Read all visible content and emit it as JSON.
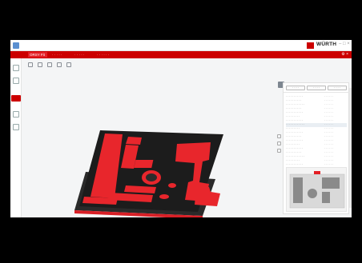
{
  "window": {
    "brand": "WÜRTH",
    "controls": "– □ ×"
  },
  "tabs": [
    {
      "label": "ORSY Fit"
    },
    {
      "label": "· · · · ·"
    },
    {
      "label": "· · · · ·"
    },
    {
      "label": "· · · · · ·"
    }
  ],
  "redbar_right": "⚙ ×",
  "toolbar": {
    "items": [
      {
        "icon": "undo-icon"
      },
      {
        "icon": "redo-icon"
      },
      {
        "icon": "copy-icon"
      },
      {
        "icon": "rotate-icon"
      },
      {
        "icon": "layer-icon"
      }
    ]
  },
  "sidebar": {
    "items": [
      {
        "icon": "inlay-icon"
      },
      {
        "icon": "layers-icon"
      },
      {
        "icon": "foam-color-icon",
        "active": true
      },
      {
        "icon": "tools-icon"
      },
      {
        "icon": "cart-icon"
      }
    ]
  },
  "panel": {
    "buttons": [
      "· · · ·",
      "· · · ·",
      "· · · ·"
    ],
    "rows": [
      {
        "name": "· · · · · · · · · · ·",
        "code": "· · · · · ·"
      },
      {
        "name": "· · · · · · · · · ·",
        "code": "· · · · · ·"
      },
      {
        "name": "· · · · · · · · · · · ·",
        "code": "· · · · · ·"
      },
      {
        "name": "· · · · · · · · · ·",
        "code": "· · · · · ·"
      },
      {
        "name": "· · · · · · · · · · ·",
        "code": "· · · · · ·"
      },
      {
        "name": "· · · · · · · · ·",
        "code": "· · · · · ·"
      },
      {
        "name": "· · · · · · · · · · ·",
        "code": "· · · · · ·"
      },
      {
        "name": "· · · · · · · · · · · ·",
        "code": "· · · · · ·",
        "selected": true
      },
      {
        "name": "· · · · · · · · ·",
        "code": "· · · · · ·"
      },
      {
        "name": "· · · · · · · · · · ·",
        "code": "· · · · · ·"
      },
      {
        "name": "· · · · · · · · · ·",
        "code": "· · · · · ·"
      },
      {
        "name": "· · · · · · · · · · ·",
        "code": "· · · · · ·"
      },
      {
        "name": "· · · · · · · · ·",
        "code": "· · · · · ·"
      },
      {
        "name": "· · · · · · · · · · ·",
        "code": "· · · · · ·"
      },
      {
        "name": "· · · · · · · · · ·",
        "code": "· · · · · ·"
      },
      {
        "name": "· · · · · · · · · · · ·",
        "code": "· · · · · ·"
      },
      {
        "name": "· · · · · · · · ·",
        "code": "· · · · · ·"
      },
      {
        "name": "· · · · · · · · · · ·",
        "code": "· · · · · ·"
      }
    ]
  },
  "colors": {
    "brand_red": "#cc0000",
    "foam_red": "#e8262c",
    "tray_black": "#1c1c1c"
  }
}
